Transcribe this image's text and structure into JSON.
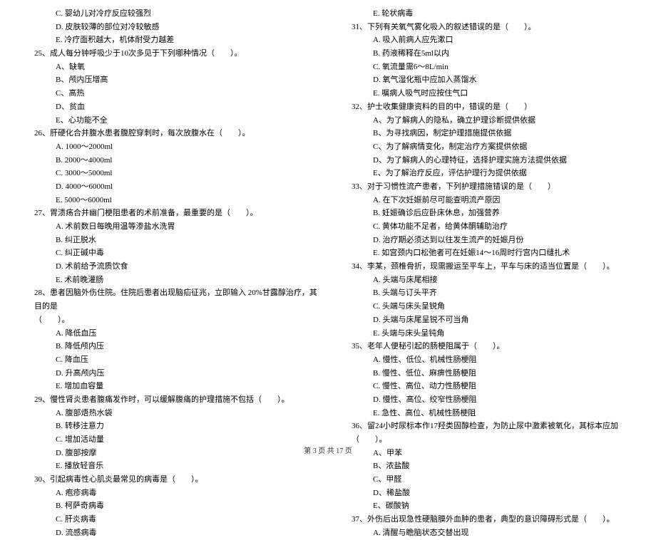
{
  "left": [
    {
      "type": "opt",
      "text": "C. 婴幼儿对冷疗反应较强烈"
    },
    {
      "type": "opt",
      "text": "D. 皮肤较薄的部位对冷较敏感"
    },
    {
      "type": "opt",
      "text": "E. 冷疗面积越大，机体耐受力越差"
    },
    {
      "type": "q",
      "text": "25、成人每分钟呼吸少于10次多见于下列哪种情况（　　）。"
    },
    {
      "type": "opt",
      "text": "A、缺氧"
    },
    {
      "type": "opt",
      "text": "B、颅内压增高"
    },
    {
      "type": "opt",
      "text": "C、高热"
    },
    {
      "type": "opt",
      "text": "D、贫血"
    },
    {
      "type": "opt",
      "text": "E、心功能不全"
    },
    {
      "type": "q",
      "text": "26、肝硬化合并腹水患者腹腔穿刺时，每次放腹水在（　　）。"
    },
    {
      "type": "opt",
      "text": "A. 1000～2000ml"
    },
    {
      "type": "opt",
      "text": "B. 2000～4000ml"
    },
    {
      "type": "opt",
      "text": "C. 3000～5000ml"
    },
    {
      "type": "opt",
      "text": "D. 4000～6000ml"
    },
    {
      "type": "opt",
      "text": "E. 5000～6000ml"
    },
    {
      "type": "q",
      "text": "27、胃溃疡合并幽门梗阻患者的术前准备，最重要的是（　　）。"
    },
    {
      "type": "opt",
      "text": "A. 术前数日每晚用温等渗盐水洗胃"
    },
    {
      "type": "opt",
      "text": "B. 纠正脱水"
    },
    {
      "type": "opt",
      "text": "C. 纠正碱中毒"
    },
    {
      "type": "opt",
      "text": "D. 术前给予流质饮食"
    },
    {
      "type": "opt",
      "text": "E. 术前晚灌肠"
    },
    {
      "type": "q",
      "text": "28、患者因脑外伤住院。住院后患者出现脑疝征兆，立即输入 20%甘露醇治疗，其目的是"
    },
    {
      "type": "q2",
      "text": "（　　）。"
    },
    {
      "type": "opt",
      "text": "A. 降低血压"
    },
    {
      "type": "opt",
      "text": "B. 降低颅内压"
    },
    {
      "type": "opt",
      "text": "C. 降血压"
    },
    {
      "type": "opt",
      "text": "D. 升高颅内压"
    },
    {
      "type": "opt",
      "text": "E. 增加血容量"
    },
    {
      "type": "q",
      "text": "29、慢性肾炎患者腹痛发作时，可以缓解腹痛的护理措施不包括（　　）。"
    },
    {
      "type": "opt",
      "text": "A. 腹部焐热水袋"
    },
    {
      "type": "opt",
      "text": "B. 转移注意力"
    },
    {
      "type": "opt",
      "text": "C. 增加活动量"
    },
    {
      "type": "opt",
      "text": "D. 腹部按摩"
    },
    {
      "type": "opt",
      "text": "E. 播放轻音乐"
    },
    {
      "type": "q",
      "text": "30、引起病毒性心肌炎最常见的病毒是（　　）。"
    },
    {
      "type": "opt",
      "text": "A. 疱疹病毒"
    },
    {
      "type": "opt",
      "text": "B. 柯萨奇病毒"
    },
    {
      "type": "opt",
      "text": "C. 肝炎病毒"
    },
    {
      "type": "opt",
      "text": "D. 流感病毒"
    }
  ],
  "right": [
    {
      "type": "opt",
      "text": "E. 轮状病毒"
    },
    {
      "type": "q",
      "text": "31、下列有关氧气雾化吸入的叙述错误的是（　　）。"
    },
    {
      "type": "opt",
      "text": "A. 吸入前病人应先漱口"
    },
    {
      "type": "opt",
      "text": "B. 药液稀释在5ml以内"
    },
    {
      "type": "opt",
      "text": "C. 氧流量需6～8L/min"
    },
    {
      "type": "opt",
      "text": "D. 氧气湿化瓶中应加入蒸馏水"
    },
    {
      "type": "opt",
      "text": "E. 嘱病人吸气时应按住气口"
    },
    {
      "type": "q",
      "text": "32、护士收集健康资料的目的中，错误的是（　　）"
    },
    {
      "type": "opt",
      "text": "A、为了解病人的隐私，确立护理诊断提供依据"
    },
    {
      "type": "opt",
      "text": "B、为寻找病因，制定护理措施提供依据"
    },
    {
      "type": "opt",
      "text": "C、为了解病情变化，制定治疗方案提供依据"
    },
    {
      "type": "opt",
      "text": "D、为了解病人的心理特征，选择护理实施方法提供依据"
    },
    {
      "type": "opt",
      "text": "E、为了解治疗反应，评估护理行为提供依据"
    },
    {
      "type": "q",
      "text": "33、对于习惯性流产患者，下列护理措施错误的是（　　）"
    },
    {
      "type": "opt",
      "text": "A. 在下次妊娠前尽可能查明流产原因"
    },
    {
      "type": "opt",
      "text": "B. 妊娠确诊后应卧床休息，加强营养"
    },
    {
      "type": "opt",
      "text": "C. 黄体功能不足者，给黄体酮辅助治疗"
    },
    {
      "type": "opt",
      "text": "D. 治疗期必须达到以往发生流产的妊娠月份"
    },
    {
      "type": "opt",
      "text": "E. 如宫颈内口松弛者可在妊娠14～16周时行宫内口缝扎术"
    },
    {
      "type": "q",
      "text": "34、李某，颈椎骨折，现需搬运至平车上，平车与床的适当位置是（　　）。"
    },
    {
      "type": "opt",
      "text": "A. 头端与床尾相接"
    },
    {
      "type": "opt",
      "text": "B. 头端与订头平齐"
    },
    {
      "type": "opt",
      "text": "C. 头端与床头呈锐角"
    },
    {
      "type": "opt",
      "text": "D. 头端与床尾呈锐不可当角"
    },
    {
      "type": "opt",
      "text": "E. 头端与床头呈钝角"
    },
    {
      "type": "q",
      "text": "35、老年人便秘引起的肠梗阻属于（　　）。"
    },
    {
      "type": "opt",
      "text": "A. 慢性、低位、机械性肠梗阻"
    },
    {
      "type": "opt",
      "text": "B. 慢性、低位、麻痹性肠梗阻"
    },
    {
      "type": "opt",
      "text": "C. 慢性、高位、动力性肠梗阻"
    },
    {
      "type": "opt",
      "text": "D. 慢性、高位、绞窄性肠梗阻"
    },
    {
      "type": "opt",
      "text": "E. 急性、高位、机械性肠梗阻"
    },
    {
      "type": "q",
      "text": "36、留24小时尿标本作17羟类固醇检查，为防止尿中激素被氧化，其标本应加（　　）。"
    },
    {
      "type": "opt",
      "text": "A、甲苯"
    },
    {
      "type": "opt",
      "text": "B、浓盐酸"
    },
    {
      "type": "opt",
      "text": "C、甲醛"
    },
    {
      "type": "opt",
      "text": "D、稀盐酸"
    },
    {
      "type": "opt",
      "text": "E、碳酸钠"
    },
    {
      "type": "q",
      "text": "37、外伤后出现急性硬脑膜外血肿的患者，典型的意识障碍形式是（　　）。"
    },
    {
      "type": "opt",
      "text": "A. 清醒与瞻脑状态交替出现"
    }
  ],
  "footer": "第 3 页 共 17 页"
}
